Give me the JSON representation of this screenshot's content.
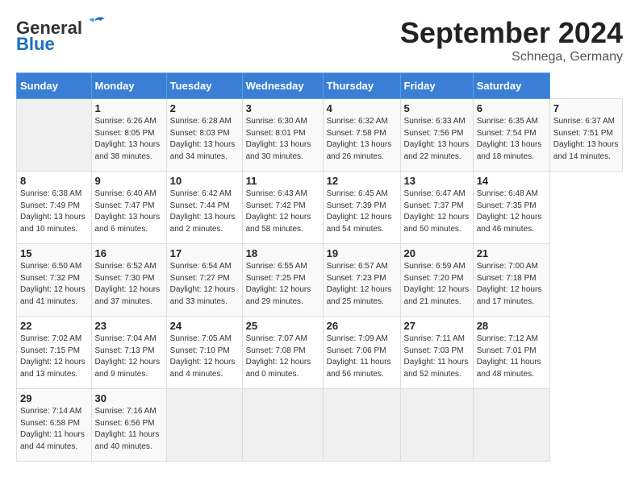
{
  "header": {
    "logo_general": "General",
    "logo_blue": "Blue",
    "title": "September 2024",
    "location": "Schnega, Germany"
  },
  "calendar": {
    "days_of_week": [
      "Sunday",
      "Monday",
      "Tuesday",
      "Wednesday",
      "Thursday",
      "Friday",
      "Saturday"
    ],
    "weeks": [
      [
        {
          "day": null,
          "info": null
        },
        {
          "day": "1",
          "sunrise": "6:26 AM",
          "sunset": "8:05 PM",
          "daylight": "13 hours and 38 minutes."
        },
        {
          "day": "2",
          "sunrise": "6:28 AM",
          "sunset": "8:03 PM",
          "daylight": "13 hours and 34 minutes."
        },
        {
          "day": "3",
          "sunrise": "6:30 AM",
          "sunset": "8:01 PM",
          "daylight": "13 hours and 30 minutes."
        },
        {
          "day": "4",
          "sunrise": "6:32 AM",
          "sunset": "7:58 PM",
          "daylight": "13 hours and 26 minutes."
        },
        {
          "day": "5",
          "sunrise": "6:33 AM",
          "sunset": "7:56 PM",
          "daylight": "13 hours and 22 minutes."
        },
        {
          "day": "6",
          "sunrise": "6:35 AM",
          "sunset": "7:54 PM",
          "daylight": "13 hours and 18 minutes."
        },
        {
          "day": "7",
          "sunrise": "6:37 AM",
          "sunset": "7:51 PM",
          "daylight": "13 hours and 14 minutes."
        }
      ],
      [
        {
          "day": "8",
          "sunrise": "6:38 AM",
          "sunset": "7:49 PM",
          "daylight": "13 hours and 10 minutes."
        },
        {
          "day": "9",
          "sunrise": "6:40 AM",
          "sunset": "7:47 PM",
          "daylight": "13 hours and 6 minutes."
        },
        {
          "day": "10",
          "sunrise": "6:42 AM",
          "sunset": "7:44 PM",
          "daylight": "13 hours and 2 minutes."
        },
        {
          "day": "11",
          "sunrise": "6:43 AM",
          "sunset": "7:42 PM",
          "daylight": "12 hours and 58 minutes."
        },
        {
          "day": "12",
          "sunrise": "6:45 AM",
          "sunset": "7:39 PM",
          "daylight": "12 hours and 54 minutes."
        },
        {
          "day": "13",
          "sunrise": "6:47 AM",
          "sunset": "7:37 PM",
          "daylight": "12 hours and 50 minutes."
        },
        {
          "day": "14",
          "sunrise": "6:48 AM",
          "sunset": "7:35 PM",
          "daylight": "12 hours and 46 minutes."
        }
      ],
      [
        {
          "day": "15",
          "sunrise": "6:50 AM",
          "sunset": "7:32 PM",
          "daylight": "12 hours and 41 minutes."
        },
        {
          "day": "16",
          "sunrise": "6:52 AM",
          "sunset": "7:30 PM",
          "daylight": "12 hours and 37 minutes."
        },
        {
          "day": "17",
          "sunrise": "6:54 AM",
          "sunset": "7:27 PM",
          "daylight": "12 hours and 33 minutes."
        },
        {
          "day": "18",
          "sunrise": "6:55 AM",
          "sunset": "7:25 PM",
          "daylight": "12 hours and 29 minutes."
        },
        {
          "day": "19",
          "sunrise": "6:57 AM",
          "sunset": "7:23 PM",
          "daylight": "12 hours and 25 minutes."
        },
        {
          "day": "20",
          "sunrise": "6:59 AM",
          "sunset": "7:20 PM",
          "daylight": "12 hours and 21 minutes."
        },
        {
          "day": "21",
          "sunrise": "7:00 AM",
          "sunset": "7:18 PM",
          "daylight": "12 hours and 17 minutes."
        }
      ],
      [
        {
          "day": "22",
          "sunrise": "7:02 AM",
          "sunset": "7:15 PM",
          "daylight": "12 hours and 13 minutes."
        },
        {
          "day": "23",
          "sunrise": "7:04 AM",
          "sunset": "7:13 PM",
          "daylight": "12 hours and 9 minutes."
        },
        {
          "day": "24",
          "sunrise": "7:05 AM",
          "sunset": "7:10 PM",
          "daylight": "12 hours and 4 minutes."
        },
        {
          "day": "25",
          "sunrise": "7:07 AM",
          "sunset": "7:08 PM",
          "daylight": "12 hours and 0 minutes."
        },
        {
          "day": "26",
          "sunrise": "7:09 AM",
          "sunset": "7:06 PM",
          "daylight": "11 hours and 56 minutes."
        },
        {
          "day": "27",
          "sunrise": "7:11 AM",
          "sunset": "7:03 PM",
          "daylight": "11 hours and 52 minutes."
        },
        {
          "day": "28",
          "sunrise": "7:12 AM",
          "sunset": "7:01 PM",
          "daylight": "11 hours and 48 minutes."
        }
      ],
      [
        {
          "day": "29",
          "sunrise": "7:14 AM",
          "sunset": "6:58 PM",
          "daylight": "11 hours and 44 minutes."
        },
        {
          "day": "30",
          "sunrise": "7:16 AM",
          "sunset": "6:56 PM",
          "daylight": "11 hours and 40 minutes."
        },
        {
          "day": null,
          "info": null
        },
        {
          "day": null,
          "info": null
        },
        {
          "day": null,
          "info": null
        },
        {
          "day": null,
          "info": null
        },
        {
          "day": null,
          "info": null
        }
      ]
    ]
  }
}
